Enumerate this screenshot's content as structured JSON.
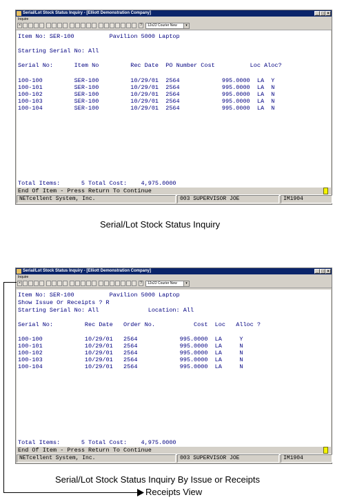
{
  "window1": {
    "title": "Serial/Lot Stock Status Inquiry - [Elliott Demonstration Company]",
    "menu": "Inquire",
    "font_select": "12x22 Courier New",
    "item_line": "Item No: SER-100          Pavilion 5000 Laptop",
    "start_line": "Starting Serial No: All",
    "header_line": "Serial No:      Item No         Rec Date  PO Number Cost          Loc Aloc?",
    "rows": [
      "100-100         SER-100         10/29/01  2564            995.0000  LA  Y",
      "100-101         SER-100         10/29/01  2564            995.0000  LA  N",
      "100-102         SER-100         10/29/01  2564            995.0000  LA  N",
      "100-103         SER-100         10/29/01  2564            995.0000  LA  N",
      "100-104         SER-100         10/29/01  2564            995.0000  LA  N"
    ],
    "totals_line": "Total Items:      5 Total Cost:    4,975.0000",
    "end_line": "End Of Item - Press Return To Continue",
    "status_company": "NETcellent System, Inc.",
    "status_user": "003 SUPERVISOR JOE",
    "status_code": "IM1904"
  },
  "caption1": "Serial/Lot Stock Status Inquiry",
  "window2": {
    "title": "Serial/Lot Stock Status Inquiry - [Elliott Demonstration Company]",
    "menu": "Inquire",
    "font_select": "12x22 Courier New",
    "item_line": "Item No: SER-100          Pavilion 5000 Laptop",
    "show_line": "Show Issue Or Receipts ? R",
    "start_line": "Starting Serial No: All              Location: All",
    "header_line": "Serial No:         Rec Date   Order No.           Cost  Loc   Alloc ?",
    "rows": [
      "100-100            10/29/01   2564            995.0000  LA     Y",
      "100-101            10/29/01   2564            995.0000  LA     N",
      "100-102            10/29/01   2564            995.0000  LA     N",
      "100-103            10/29/01   2564            995.0000  LA     N",
      "100-104            10/29/01   2564            995.0000  LA     N"
    ],
    "totals_line": "Total Items:      5 Total Cost:    4,975.0000",
    "end_line": "End Of Item - Press Return To Continue",
    "status_company": "NETcellent System, Inc.",
    "status_user": "003 SUPERVISOR JOE",
    "status_code": "IM1904"
  },
  "caption2": "Serial/Lot Stock Status Inquiry By Issue or Receipts",
  "caption3": "Receipts View",
  "colors": {
    "term_text": "#000080",
    "title_bar": "#0a246a",
    "cursor": "#f4f400"
  }
}
